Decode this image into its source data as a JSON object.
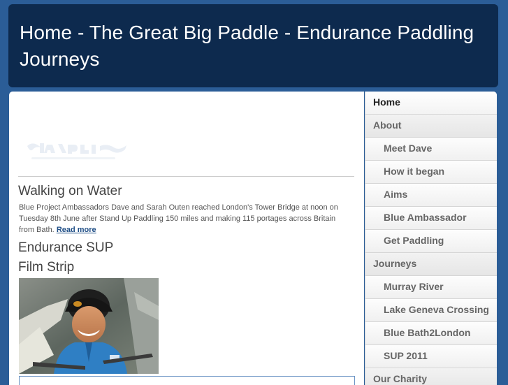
{
  "site": {
    "title": "Home - The Great Big Paddle - Endurance Paddling Journeys"
  },
  "main": {
    "post": {
      "title": "Walking on Water",
      "excerpt": "Blue Project Ambassadors Dave and Sarah Outen reached London's Tower Bridge at noon on Tuesday 8th June after Stand Up Paddling 150 miles and making 115 portages across Britain from Bath.",
      "read_more": "Read more"
    },
    "section": {
      "title": "Endurance SUP",
      "subtitle": "Film Strip"
    }
  },
  "sidebar": {
    "items": [
      {
        "label": "Home"
      },
      {
        "label": "About"
      },
      {
        "label": "Meet Dave"
      },
      {
        "label": "How it began"
      },
      {
        "label": "Aims"
      },
      {
        "label": "Blue Ambassador"
      },
      {
        "label": "Get Paddling"
      },
      {
        "label": "Journeys"
      },
      {
        "label": "Murray River"
      },
      {
        "label": "Lake Geneva Crossing"
      },
      {
        "label": "Blue Bath2London"
      },
      {
        "label": "SUP 2011"
      },
      {
        "label": "Our Charity"
      }
    ]
  },
  "colors": {
    "page_background": "#2b5d97",
    "header_background": "#0d2a4e",
    "link": "#1f4e86"
  }
}
